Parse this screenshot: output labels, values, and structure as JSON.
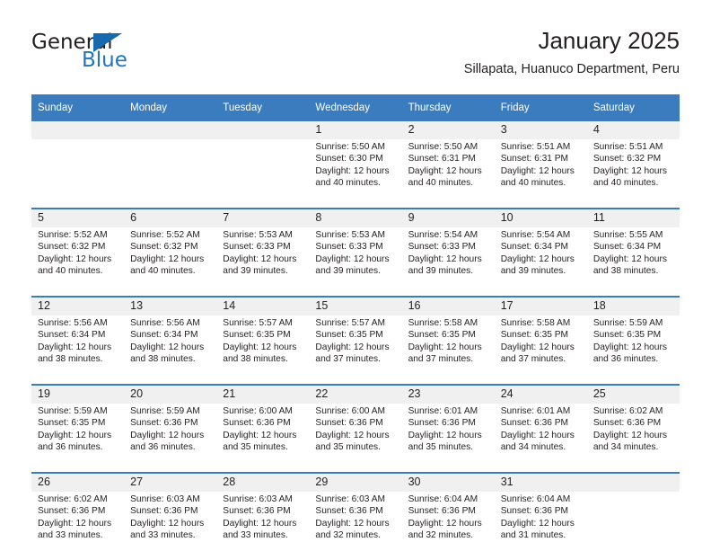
{
  "brand": {
    "name_part1": "General",
    "name_part2": "Blue",
    "triangle_icon": "triangle-icon",
    "accent_color": "#1769ad"
  },
  "header": {
    "title": "January 2025",
    "subtitle": "Sillapata, Huanuco Department, Peru",
    "header_bg_color": "#3b7cbe",
    "daynum_bg_color": "#f0f0f0"
  },
  "weekdays": [
    "Sunday",
    "Monday",
    "Tuesday",
    "Wednesday",
    "Thursday",
    "Friday",
    "Saturday"
  ],
  "weeks": [
    {
      "days": [
        {
          "day": "",
          "empty": true,
          "sunrise": "",
          "sunset": "",
          "daylight1": "",
          "daylight2": ""
        },
        {
          "day": "",
          "empty": true,
          "sunrise": "",
          "sunset": "",
          "daylight1": "",
          "daylight2": ""
        },
        {
          "day": "",
          "empty": true,
          "sunrise": "",
          "sunset": "",
          "daylight1": "",
          "daylight2": ""
        },
        {
          "day": "1",
          "empty": false,
          "sunrise": "Sunrise: 5:50 AM",
          "sunset": "Sunset: 6:30 PM",
          "daylight1": "Daylight: 12 hours",
          "daylight2": "and 40 minutes."
        },
        {
          "day": "2",
          "empty": false,
          "sunrise": "Sunrise: 5:50 AM",
          "sunset": "Sunset: 6:31 PM",
          "daylight1": "Daylight: 12 hours",
          "daylight2": "and 40 minutes."
        },
        {
          "day": "3",
          "empty": false,
          "sunrise": "Sunrise: 5:51 AM",
          "sunset": "Sunset: 6:31 PM",
          "daylight1": "Daylight: 12 hours",
          "daylight2": "and 40 minutes."
        },
        {
          "day": "4",
          "empty": false,
          "sunrise": "Sunrise: 5:51 AM",
          "sunset": "Sunset: 6:32 PM",
          "daylight1": "Daylight: 12 hours",
          "daylight2": "and 40 minutes."
        }
      ]
    },
    {
      "days": [
        {
          "day": "5",
          "empty": false,
          "sunrise": "Sunrise: 5:52 AM",
          "sunset": "Sunset: 6:32 PM",
          "daylight1": "Daylight: 12 hours",
          "daylight2": "and 40 minutes."
        },
        {
          "day": "6",
          "empty": false,
          "sunrise": "Sunrise: 5:52 AM",
          "sunset": "Sunset: 6:32 PM",
          "daylight1": "Daylight: 12 hours",
          "daylight2": "and 40 minutes."
        },
        {
          "day": "7",
          "empty": false,
          "sunrise": "Sunrise: 5:53 AM",
          "sunset": "Sunset: 6:33 PM",
          "daylight1": "Daylight: 12 hours",
          "daylight2": "and 39 minutes."
        },
        {
          "day": "8",
          "empty": false,
          "sunrise": "Sunrise: 5:53 AM",
          "sunset": "Sunset: 6:33 PM",
          "daylight1": "Daylight: 12 hours",
          "daylight2": "and 39 minutes."
        },
        {
          "day": "9",
          "empty": false,
          "sunrise": "Sunrise: 5:54 AM",
          "sunset": "Sunset: 6:33 PM",
          "daylight1": "Daylight: 12 hours",
          "daylight2": "and 39 minutes."
        },
        {
          "day": "10",
          "empty": false,
          "sunrise": "Sunrise: 5:54 AM",
          "sunset": "Sunset: 6:34 PM",
          "daylight1": "Daylight: 12 hours",
          "daylight2": "and 39 minutes."
        },
        {
          "day": "11",
          "empty": false,
          "sunrise": "Sunrise: 5:55 AM",
          "sunset": "Sunset: 6:34 PM",
          "daylight1": "Daylight: 12 hours",
          "daylight2": "and 38 minutes."
        }
      ]
    },
    {
      "days": [
        {
          "day": "12",
          "empty": false,
          "sunrise": "Sunrise: 5:56 AM",
          "sunset": "Sunset: 6:34 PM",
          "daylight1": "Daylight: 12 hours",
          "daylight2": "and 38 minutes."
        },
        {
          "day": "13",
          "empty": false,
          "sunrise": "Sunrise: 5:56 AM",
          "sunset": "Sunset: 6:34 PM",
          "daylight1": "Daylight: 12 hours",
          "daylight2": "and 38 minutes."
        },
        {
          "day": "14",
          "empty": false,
          "sunrise": "Sunrise: 5:57 AM",
          "sunset": "Sunset: 6:35 PM",
          "daylight1": "Daylight: 12 hours",
          "daylight2": "and 38 minutes."
        },
        {
          "day": "15",
          "empty": false,
          "sunrise": "Sunrise: 5:57 AM",
          "sunset": "Sunset: 6:35 PM",
          "daylight1": "Daylight: 12 hours",
          "daylight2": "and 37 minutes."
        },
        {
          "day": "16",
          "empty": false,
          "sunrise": "Sunrise: 5:58 AM",
          "sunset": "Sunset: 6:35 PM",
          "daylight1": "Daylight: 12 hours",
          "daylight2": "and 37 minutes."
        },
        {
          "day": "17",
          "empty": false,
          "sunrise": "Sunrise: 5:58 AM",
          "sunset": "Sunset: 6:35 PM",
          "daylight1": "Daylight: 12 hours",
          "daylight2": "and 37 minutes."
        },
        {
          "day": "18",
          "empty": false,
          "sunrise": "Sunrise: 5:59 AM",
          "sunset": "Sunset: 6:35 PM",
          "daylight1": "Daylight: 12 hours",
          "daylight2": "and 36 minutes."
        }
      ]
    },
    {
      "days": [
        {
          "day": "19",
          "empty": false,
          "sunrise": "Sunrise: 5:59 AM",
          "sunset": "Sunset: 6:35 PM",
          "daylight1": "Daylight: 12 hours",
          "daylight2": "and 36 minutes."
        },
        {
          "day": "20",
          "empty": false,
          "sunrise": "Sunrise: 5:59 AM",
          "sunset": "Sunset: 6:36 PM",
          "daylight1": "Daylight: 12 hours",
          "daylight2": "and 36 minutes."
        },
        {
          "day": "21",
          "empty": false,
          "sunrise": "Sunrise: 6:00 AM",
          "sunset": "Sunset: 6:36 PM",
          "daylight1": "Daylight: 12 hours",
          "daylight2": "and 35 minutes."
        },
        {
          "day": "22",
          "empty": false,
          "sunrise": "Sunrise: 6:00 AM",
          "sunset": "Sunset: 6:36 PM",
          "daylight1": "Daylight: 12 hours",
          "daylight2": "and 35 minutes."
        },
        {
          "day": "23",
          "empty": false,
          "sunrise": "Sunrise: 6:01 AM",
          "sunset": "Sunset: 6:36 PM",
          "daylight1": "Daylight: 12 hours",
          "daylight2": "and 35 minutes."
        },
        {
          "day": "24",
          "empty": false,
          "sunrise": "Sunrise: 6:01 AM",
          "sunset": "Sunset: 6:36 PM",
          "daylight1": "Daylight: 12 hours",
          "daylight2": "and 34 minutes."
        },
        {
          "day": "25",
          "empty": false,
          "sunrise": "Sunrise: 6:02 AM",
          "sunset": "Sunset: 6:36 PM",
          "daylight1": "Daylight: 12 hours",
          "daylight2": "and 34 minutes."
        }
      ]
    },
    {
      "days": [
        {
          "day": "26",
          "empty": false,
          "sunrise": "Sunrise: 6:02 AM",
          "sunset": "Sunset: 6:36 PM",
          "daylight1": "Daylight: 12 hours",
          "daylight2": "and 33 minutes."
        },
        {
          "day": "27",
          "empty": false,
          "sunrise": "Sunrise: 6:03 AM",
          "sunset": "Sunset: 6:36 PM",
          "daylight1": "Daylight: 12 hours",
          "daylight2": "and 33 minutes."
        },
        {
          "day": "28",
          "empty": false,
          "sunrise": "Sunrise: 6:03 AM",
          "sunset": "Sunset: 6:36 PM",
          "daylight1": "Daylight: 12 hours",
          "daylight2": "and 33 minutes."
        },
        {
          "day": "29",
          "empty": false,
          "sunrise": "Sunrise: 6:03 AM",
          "sunset": "Sunset: 6:36 PM",
          "daylight1": "Daylight: 12 hours",
          "daylight2": "and 32 minutes."
        },
        {
          "day": "30",
          "empty": false,
          "sunrise": "Sunrise: 6:04 AM",
          "sunset": "Sunset: 6:36 PM",
          "daylight1": "Daylight: 12 hours",
          "daylight2": "and 32 minutes."
        },
        {
          "day": "31",
          "empty": false,
          "sunrise": "Sunrise: 6:04 AM",
          "sunset": "Sunset: 6:36 PM",
          "daylight1": "Daylight: 12 hours",
          "daylight2": "and 31 minutes."
        },
        {
          "day": "",
          "empty": true,
          "sunrise": "",
          "sunset": "",
          "daylight1": "",
          "daylight2": ""
        }
      ]
    }
  ]
}
